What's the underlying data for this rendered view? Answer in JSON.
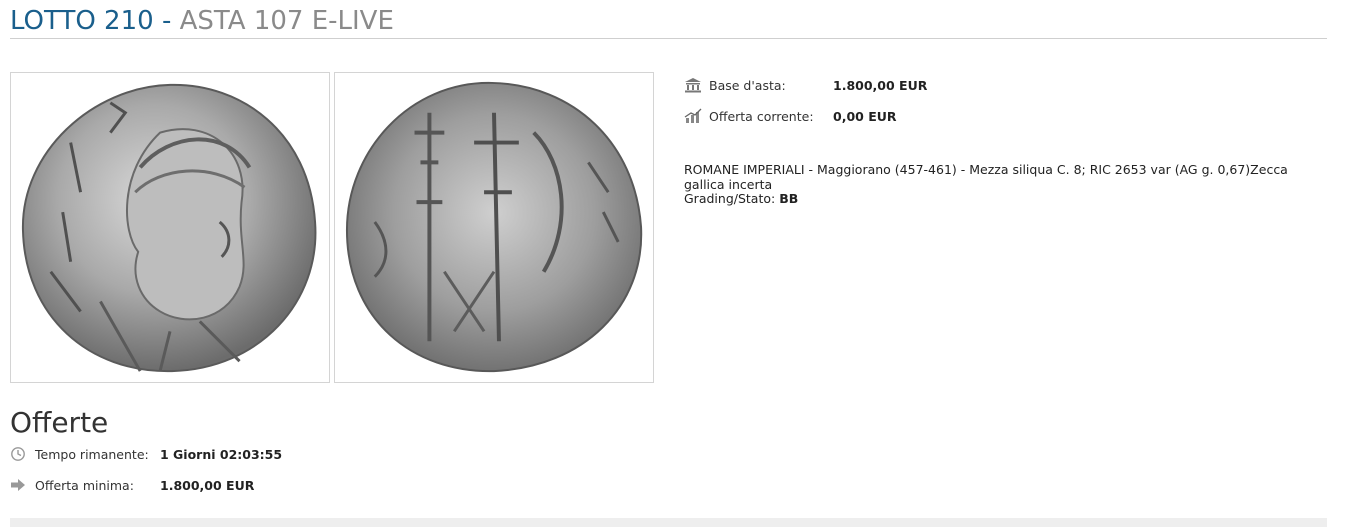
{
  "header": {
    "lot": "LOTTO 210",
    "separator": "-",
    "auction": "ASTA 107 E-LIVE"
  },
  "images": {
    "front_alt": "",
    "back_alt": ""
  },
  "info": {
    "base_label": "Base d'asta:",
    "base_value": "1.800,00 EUR",
    "current_label": "Offerta corrente:",
    "current_value": "0,00 EUR",
    "base_icon": "bank-icon",
    "current_icon": "chart-icon"
  },
  "description": {
    "text": "ROMANE IMPERIALI - Maggiorano (457-461) - Mezza siliqua C. 8; RIC 2653 var (AG g. 0,67)Zecca gallica incerta",
    "grading_label": "Grading/Stato:",
    "grading_value": "BB"
  },
  "offers": {
    "title": "Offerte",
    "time_label": "Tempo rimanente:",
    "time_value": "1 Giorni 02:03:55",
    "min_label": "Offerta minima:",
    "min_value": "1.800,00 EUR",
    "time_icon": "clock-icon",
    "min_icon": "arrow-right-icon"
  },
  "colors": {
    "title_blue": "#1a5f8c",
    "title_grey": "#8a8a8a",
    "divider": "#cfcfcf"
  }
}
